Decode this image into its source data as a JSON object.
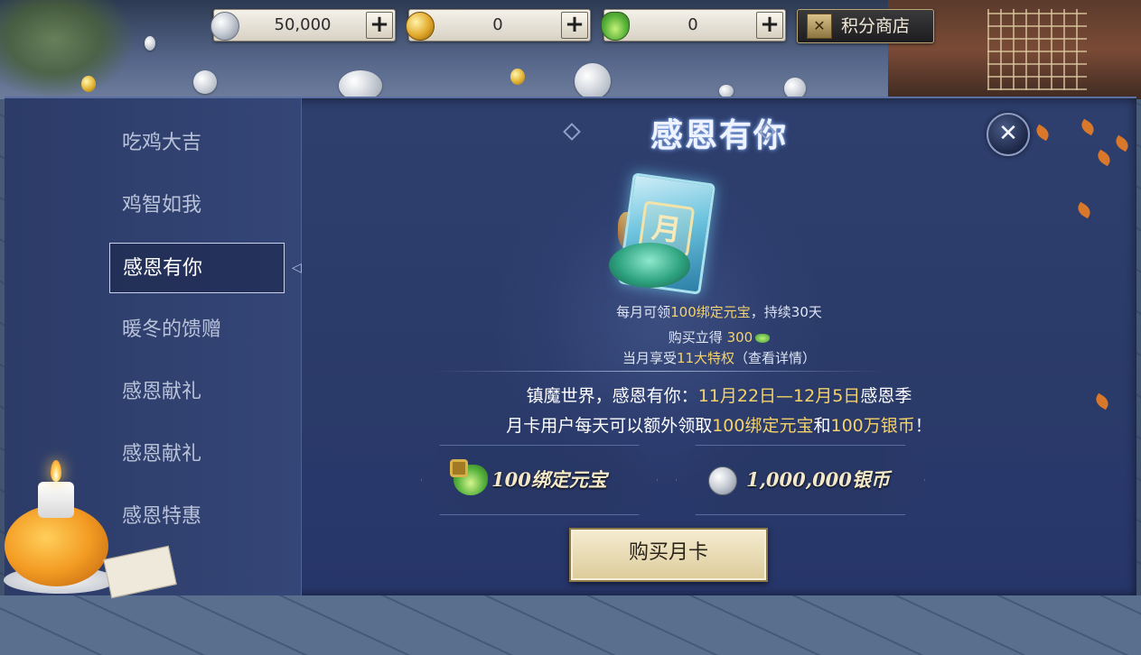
{
  "topbar": {
    "silver": {
      "value": "50,000",
      "plus": "+"
    },
    "gold": {
      "value": "0",
      "plus": "+"
    },
    "ingot": {
      "value": "0",
      "plus": "+"
    },
    "shop_label": "积分商店"
  },
  "sidebar": {
    "items": [
      {
        "label": "吃鸡大吉"
      },
      {
        "label": "鸡智如我"
      },
      {
        "label": "感恩有你"
      },
      {
        "label": "暖冬的馈赠"
      },
      {
        "label": "感恩献礼"
      },
      {
        "label": "感恩献礼"
      },
      {
        "label": "感恩特惠"
      }
    ],
    "active_index": 2
  },
  "content": {
    "title": "感恩有你",
    "card_char": "月",
    "desc_line1_a": "每月可领",
    "desc_line1_b": "100绑定元宝",
    "desc_line1_c": "，持续30天",
    "desc_line2_a": "购买立得 ",
    "desc_line2_b": "300",
    "desc_line3_a": "当月享受",
    "desc_line3_b": "11大特权",
    "desc_line3_c": "（查看详情）",
    "main_line1_a": "镇魔世界，感恩有你：",
    "main_line1_b": "11月22日—12月5日",
    "main_line1_c": "感恩季",
    "main_line2_a": "月卡用户每天可以额外领取",
    "main_line2_b": "100绑定元宝",
    "main_line2_c": "和",
    "main_line2_d": "100万银币",
    "main_line2_e": "！",
    "reward1": "100绑定元宝",
    "reward2": "1,000,000银币",
    "buy_button": "购买月卡",
    "close": "✕"
  },
  "colors": {
    "panel_bg": "#2e3f6e",
    "highlight": "#f5d36a",
    "button_bg": "#f5ecd0"
  }
}
